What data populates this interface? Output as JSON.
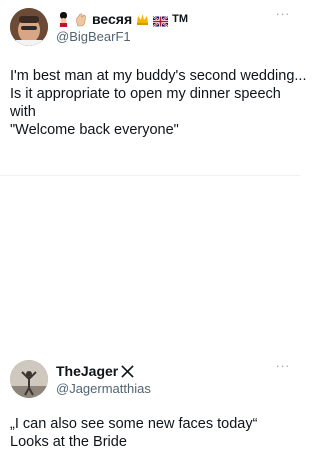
{
  "post1": {
    "display_name": "весяᴙ",
    "tm": "TM",
    "handle": "@BigBearF1",
    "more": "···",
    "lines": [
      "I'm best man at my buddy's second wedding...",
      "Is it appropriate to open my dinner speech",
      "with",
      "\"Welcome back everyone\""
    ]
  },
  "post2": {
    "display_name": "TheJager",
    "handle": "@Jagermatthias",
    "more": "···",
    "lines": [
      "„I can also see some new faces today“",
      "Looks at the Bride"
    ]
  },
  "icons": {
    "guard": "royal-guard-emoji",
    "hand": "waving-hand-emoji",
    "crown": "crown-emoji",
    "flag": "uk-flag-emoji",
    "x_logo": "x-logo",
    "more": "more-icon"
  }
}
